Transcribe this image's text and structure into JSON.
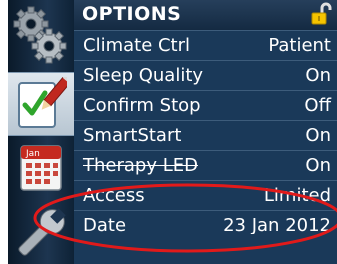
{
  "header": {
    "title": "OPTIONS",
    "lock_icon": "unlocked-padlock-icon"
  },
  "sidebar": {
    "items": [
      {
        "name": "settings",
        "icon": "gears-icon",
        "selected": false
      },
      {
        "name": "options",
        "icon": "checklist-pencil-icon",
        "selected": true
      },
      {
        "name": "calendar",
        "icon": "calendar-icon",
        "calendar_tab_text": "Jan",
        "selected": false
      },
      {
        "name": "tools",
        "icon": "wrench-icon",
        "selected": false
      }
    ]
  },
  "options": [
    {
      "label": "Climate Ctrl",
      "value": "Patient"
    },
    {
      "label": "Sleep Quality",
      "value": "On"
    },
    {
      "label": "Confirm Stop",
      "value": "Off"
    },
    {
      "label": "SmartStart",
      "value": "On"
    },
    {
      "label": "Therapy LED",
      "value": "On"
    },
    {
      "label": "Access",
      "value": "Limited",
      "highlighted": true
    },
    {
      "label": "Date",
      "value": "23 Jan 2012"
    }
  ],
  "colors": {
    "panel_bg": "#1a3959",
    "header_bg": "#142a42",
    "text": "#ffffff",
    "accent_lock": "#f5c400",
    "annotation": "#e11a1a"
  }
}
